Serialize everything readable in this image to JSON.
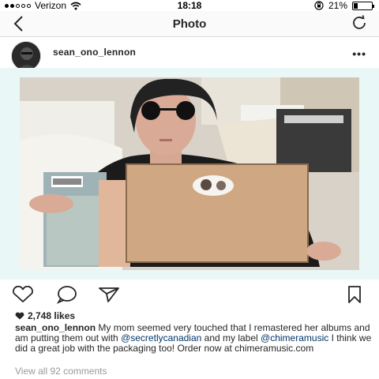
{
  "status_bar": {
    "carrier": "Verizon",
    "time": "18:18",
    "battery_percent": "21%",
    "battery_level": 0.21
  },
  "nav": {
    "title": "Photo"
  },
  "post": {
    "username": "sean_ono_lennon",
    "likes": "2,748 likes",
    "caption": {
      "user": "sean_ono_lennon",
      "text1": " My mom seemed very touched that I remastered her albums and am putting them out with ",
      "mention1": "@secretlycanadian",
      "text2": " and my label ",
      "mention2": "@chimeramusic",
      "text3": " I think we did a great job with the packaging too! Order now at chimeramusic.com"
    },
    "view_comments": "View all 92 comments"
  }
}
